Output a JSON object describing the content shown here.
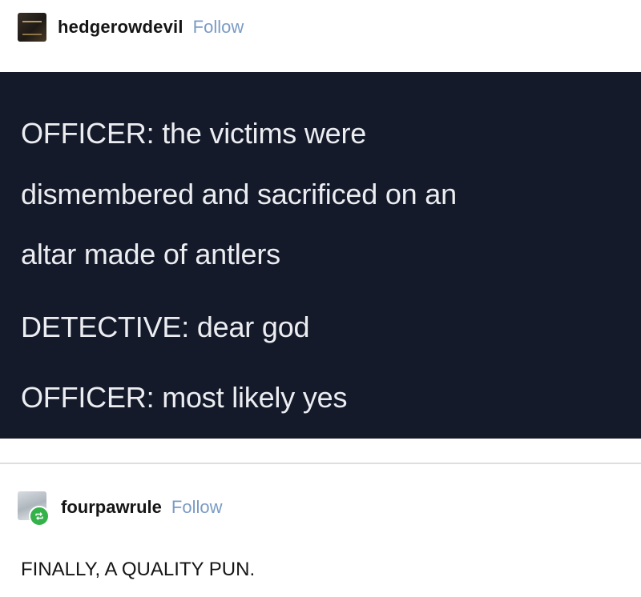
{
  "post1": {
    "username": "hedgerowdevil",
    "follow_label": "Follow",
    "avatar_icon": "profile-avatar-icon",
    "lines": [
      "OFFICER: the victims were",
      "dismembered and sacrificed on an",
      "altar made of antlers",
      "DETECTIVE: dear god",
      "OFFICER: most likely yes"
    ]
  },
  "post2": {
    "username": "fourpawrule",
    "follow_label": "Follow",
    "avatar_icon": "profile-avatar-icon",
    "badge_icon": "reblog-icon",
    "text": "FINALLY, A QUALITY PUN."
  },
  "colors": {
    "dark_background": "#141a2a",
    "dark_text": "#ecedf1",
    "follow_link": "#7a9bc4",
    "reblog_badge": "#34b24a",
    "divider": "#dedede"
  }
}
